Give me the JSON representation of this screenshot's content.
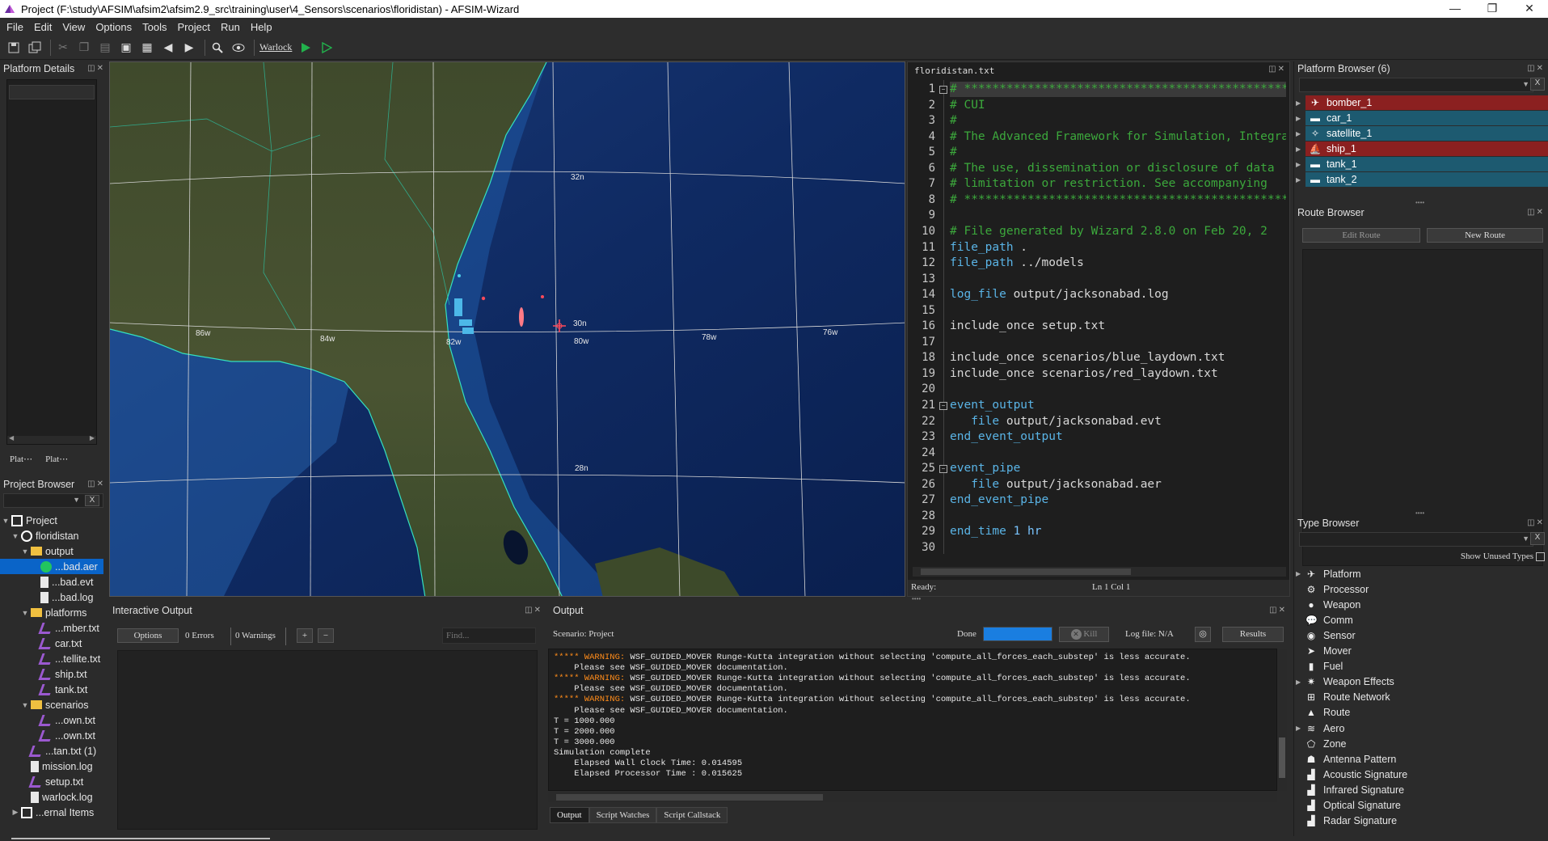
{
  "window": {
    "title": "Project (F:\\study\\AFSIM\\afsim2\\afsim2.9_src\\training\\user\\4_Sensors\\scenarios\\floridistan) - AFSIM-Wizard",
    "controls": [
      "—",
      "❐",
      "✕"
    ]
  },
  "menu": [
    "File",
    "Edit",
    "View",
    "Options",
    "Tools",
    "Project",
    "Run",
    "Help"
  ],
  "toolbar": {
    "warlock_label": "Warlock"
  },
  "platform_details": {
    "title": "Platform Details",
    "tabs": [
      "Plat⋯",
      "Plat⋯"
    ]
  },
  "project_browser": {
    "title": "Project Browser",
    "filter_x": "X",
    "items": [
      {
        "label": "Project",
        "depth": 0,
        "icon": "project-icon"
      },
      {
        "label": "floridistan",
        "depth": 1,
        "icon": "folder-circle-icon"
      },
      {
        "label": "output",
        "depth": 2,
        "icon": "folder-icon"
      },
      {
        "label": "...bad.aer",
        "depth": 3,
        "icon": "aer-file-icon",
        "selected": true
      },
      {
        "label": "...bad.evt",
        "depth": 3,
        "icon": "file-icon"
      },
      {
        "label": "...bad.log",
        "depth": 3,
        "icon": "file-icon"
      },
      {
        "label": "platforms",
        "depth": 2,
        "icon": "folder-icon"
      },
      {
        "label": "...mber.txt",
        "depth": 3,
        "icon": "script-file-icon"
      },
      {
        "label": "car.txt",
        "depth": 3,
        "icon": "script-file-icon"
      },
      {
        "label": "...tellite.txt",
        "depth": 3,
        "icon": "script-file-icon"
      },
      {
        "label": "ship.txt",
        "depth": 3,
        "icon": "script-file-icon"
      },
      {
        "label": "tank.txt",
        "depth": 3,
        "icon": "script-file-icon"
      },
      {
        "label": "scenarios",
        "depth": 2,
        "icon": "folder-icon"
      },
      {
        "label": "...own.txt",
        "depth": 3,
        "icon": "script-file-icon"
      },
      {
        "label": "...own.txt",
        "depth": 3,
        "icon": "script-file-icon"
      },
      {
        "label": "...tan.txt (1)",
        "depth": 2,
        "icon": "script-file-icon"
      },
      {
        "label": "mission.log",
        "depth": 2,
        "icon": "file-icon"
      },
      {
        "label": "setup.txt",
        "depth": 2,
        "icon": "script-file-icon"
      },
      {
        "label": "warlock.log",
        "depth": 2,
        "icon": "file-icon"
      },
      {
        "label": "...ernal Items",
        "depth": 1,
        "icon": "external-link-icon"
      }
    ]
  },
  "map": {
    "lat_labels": [
      "32n",
      "30n",
      "28n"
    ],
    "lon_labels": [
      "86w",
      "84w",
      "82w",
      "80w",
      "78w",
      "76w"
    ]
  },
  "editor": {
    "filename": "floridistan.txt",
    "lines": [
      {
        "n": "1",
        "parts": [
          {
            "c": "cm",
            "t": "# ******************************************************"
          }
        ]
      },
      {
        "n": "2",
        "parts": [
          {
            "c": "cm",
            "t": "# CUI"
          }
        ]
      },
      {
        "n": "3",
        "parts": [
          {
            "c": "cm",
            "t": "#"
          }
        ]
      },
      {
        "n": "4",
        "parts": [
          {
            "c": "cm",
            "t": "# The Advanced Framework for Simulation, Integration"
          }
        ]
      },
      {
        "n": "5",
        "parts": [
          {
            "c": "cm",
            "t": "#"
          }
        ]
      },
      {
        "n": "6",
        "parts": [
          {
            "c": "cm",
            "t": "# The use, dissemination or disclosure of data"
          }
        ]
      },
      {
        "n": "7",
        "parts": [
          {
            "c": "cm",
            "t": "# limitation or restriction. See accompanying"
          }
        ]
      },
      {
        "n": "8",
        "parts": [
          {
            "c": "cm",
            "t": "# ******************************************************"
          }
        ]
      },
      {
        "n": "9",
        "parts": []
      },
      {
        "n": "10",
        "parts": [
          {
            "c": "cm",
            "t": "# File generated by Wizard 2.8.0 on Feb 20, 2"
          }
        ]
      },
      {
        "n": "11",
        "parts": [
          {
            "c": "kw",
            "t": "file_path"
          },
          {
            "c": "tx",
            "t": " ."
          }
        ]
      },
      {
        "n": "12",
        "parts": [
          {
            "c": "kw",
            "t": "file_path"
          },
          {
            "c": "tx",
            "t": " ../models"
          }
        ]
      },
      {
        "n": "13",
        "parts": []
      },
      {
        "n": "14",
        "parts": [
          {
            "c": "kw",
            "t": "log_file"
          },
          {
            "c": "tx",
            "t": " output/jacksonabad.log"
          }
        ]
      },
      {
        "n": "15",
        "parts": []
      },
      {
        "n": "16",
        "parts": [
          {
            "c": "tx",
            "t": "include_once setup.txt"
          }
        ]
      },
      {
        "n": "17",
        "parts": []
      },
      {
        "n": "18",
        "parts": [
          {
            "c": "tx",
            "t": "include_once scenarios/blue_laydown.txt"
          }
        ]
      },
      {
        "n": "19",
        "parts": [
          {
            "c": "tx",
            "t": "include_once scenarios/red_laydown.txt"
          }
        ]
      },
      {
        "n": "20",
        "parts": []
      },
      {
        "n": "21",
        "parts": [
          {
            "c": "kw",
            "t": "event_output"
          }
        ]
      },
      {
        "n": "22",
        "parts": [
          {
            "c": "kw",
            "t": "   file"
          },
          {
            "c": "tx",
            "t": " output/jacksonabad.evt"
          }
        ]
      },
      {
        "n": "23",
        "parts": [
          {
            "c": "kw",
            "t": "end_event_output"
          }
        ]
      },
      {
        "n": "24",
        "parts": []
      },
      {
        "n": "25",
        "parts": [
          {
            "c": "kw",
            "t": "event_pipe"
          }
        ]
      },
      {
        "n": "26",
        "parts": [
          {
            "c": "kw",
            "t": "   file"
          },
          {
            "c": "tx",
            "t": " output/jacksonabad.aer"
          }
        ]
      },
      {
        "n": "27",
        "parts": [
          {
            "c": "kw",
            "t": "end_event_pipe"
          }
        ]
      },
      {
        "n": "28",
        "parts": []
      },
      {
        "n": "29",
        "parts": [
          {
            "c": "kw",
            "t": "end_time"
          },
          {
            "c": "num",
            "t": " 1 hr"
          }
        ]
      },
      {
        "n": "30",
        "parts": []
      }
    ],
    "status_left": "Ready:",
    "status_right": "Ln 1 Col 1"
  },
  "platform_browser": {
    "title": "Platform Browser (6)",
    "filter_x": "X",
    "items": [
      {
        "label": "bomber_1",
        "team": "red",
        "icon": "plane-icon"
      },
      {
        "label": "car_1",
        "team": "blue",
        "icon": "car-icon"
      },
      {
        "label": "satellite_1",
        "team": "blue",
        "icon": "satellite-icon"
      },
      {
        "label": "ship_1",
        "team": "red",
        "icon": "ship-icon"
      },
      {
        "label": "tank_1",
        "team": "blue",
        "icon": "tank-icon"
      },
      {
        "label": "tank_2",
        "team": "blue",
        "icon": "tank-icon"
      }
    ],
    "team_colors": {
      "red": "#8b2020",
      "blue": "#1d5a70"
    }
  },
  "route_browser": {
    "title": "Route Browser",
    "edit_label": "Edit Route",
    "new_label": "New Route"
  },
  "type_browser": {
    "title": "Type Browser",
    "filter_x": "X",
    "show_unused": "Show Unused Types",
    "items": [
      {
        "label": "Platform",
        "icon": "platform-icon",
        "glyph": "✈"
      },
      {
        "label": "Processor",
        "icon": "gear-icon",
        "glyph": "⚙"
      },
      {
        "label": "Weapon",
        "icon": "bomb-icon",
        "glyph": "●"
      },
      {
        "label": "Comm",
        "icon": "chat-icon",
        "glyph": "💬"
      },
      {
        "label": "Sensor",
        "icon": "radar-icon",
        "glyph": "◉"
      },
      {
        "label": "Mover",
        "icon": "mover-icon",
        "glyph": "➤"
      },
      {
        "label": "Fuel",
        "icon": "fuel-icon",
        "glyph": "▮"
      },
      {
        "label": "Weapon Effects",
        "icon": "explosion-icon",
        "glyph": "✷"
      },
      {
        "label": "Route Network",
        "icon": "network-icon",
        "glyph": "⊞"
      },
      {
        "label": "Route",
        "icon": "route-icon",
        "glyph": "▲"
      },
      {
        "label": "Aero",
        "icon": "aero-icon",
        "glyph": "≋"
      },
      {
        "label": "Zone",
        "icon": "zone-icon",
        "glyph": "⬠"
      },
      {
        "label": "Antenna Pattern",
        "icon": "antenna-icon",
        "glyph": "☗"
      },
      {
        "label": "Acoustic Signature",
        "icon": "signature-icon",
        "glyph": "▟"
      },
      {
        "label": "Infrared Signature",
        "icon": "signature-icon",
        "glyph": "▟"
      },
      {
        "label": "Optical Signature",
        "icon": "signature-icon",
        "glyph": "▟"
      },
      {
        "label": "Radar Signature",
        "icon": "signature-icon",
        "glyph": "▟"
      }
    ]
  },
  "interactive_output": {
    "title": "Interactive Output",
    "options_label": "Options",
    "errors": "0 Errors",
    "warnings": "0 Warnings",
    "plus": "+",
    "minus": "−",
    "find_placeholder": "Find..."
  },
  "output": {
    "title": "Output",
    "scenario": "Scenario: Project",
    "done_label": "Done",
    "progress": 1.0,
    "kill_label": "Kill",
    "logfile_label": "Log file: N/A",
    "results_label": "Results",
    "log": [
      {
        "warn": "***** WARNING:",
        "text": " WSF_GUIDED_MOVER Runge-Kutta integration without selecting 'compute_all_forces_each_substep' is less accurate."
      },
      {
        "warn": "",
        "text": "    Please see WSF_GUIDED_MOVER documentation."
      },
      {
        "warn": "***** WARNING:",
        "text": " WSF_GUIDED_MOVER Runge-Kutta integration without selecting 'compute_all_forces_each_substep' is less accurate."
      },
      {
        "warn": "",
        "text": "    Please see WSF_GUIDED_MOVER documentation."
      },
      {
        "warn": "***** WARNING:",
        "text": " WSF_GUIDED_MOVER Runge-Kutta integration without selecting 'compute_all_forces_each_substep' is less accurate."
      },
      {
        "warn": "",
        "text": "    Please see WSF_GUIDED_MOVER documentation."
      },
      {
        "warn": "",
        "text": "T = 1000.000"
      },
      {
        "warn": "",
        "text": "T = 2000.000"
      },
      {
        "warn": "",
        "text": "T = 3000.000"
      },
      {
        "warn": "",
        "text": "Simulation complete"
      },
      {
        "warn": "",
        "text": "    Elapsed Wall Clock Time: 0.014595"
      },
      {
        "warn": "",
        "text": "    Elapsed Processor Time : 0.015625"
      }
    ],
    "tabs": [
      "Output",
      "Script Watches",
      "Script Callstack"
    ]
  }
}
